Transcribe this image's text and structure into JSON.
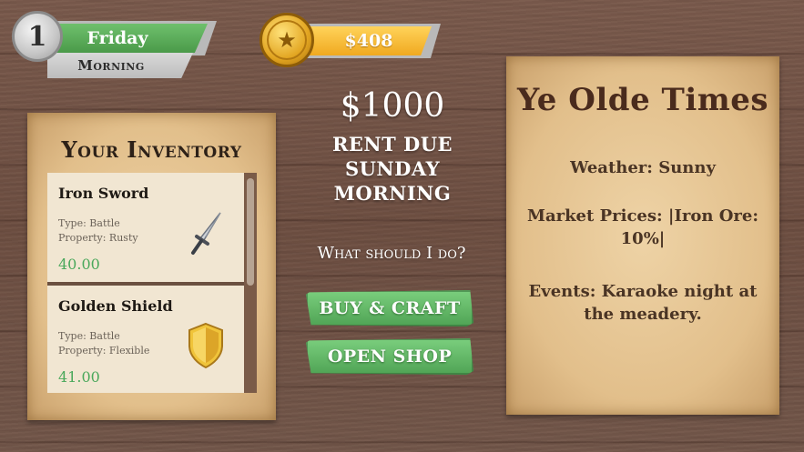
{
  "hud": {
    "day_number": "1",
    "day_name": "Friday",
    "time_of_day": "Morning",
    "money": "$408",
    "coin_icon": "star-coin-icon"
  },
  "inventory": {
    "title": "Your Inventory",
    "items": [
      {
        "name": "Iron Sword",
        "type": "Type: Battle",
        "property": "Property: Rusty",
        "price": "40.00",
        "icon": "sword-icon"
      },
      {
        "name": "Golden Shield",
        "type": "Type: Battle",
        "property": "Property: Flexible",
        "price": "41.00",
        "icon": "shield-icon"
      }
    ]
  },
  "rent": {
    "amount": "$1000",
    "line1": "RENT DUE",
    "line2": "SUNDAY",
    "line3": "MORNING"
  },
  "actions": {
    "prompt": "What should I do?",
    "buy_craft": "BUY & CRAFT",
    "open_shop": "OPEN SHOP"
  },
  "news": {
    "title": "Ye Olde Times",
    "weather": "Weather: Sunny",
    "market": "Market Prices: |Iron Ore: 10%|",
    "events": "Events: Karaoke night at the meadery."
  },
  "colors": {
    "day_ribbon": "#5aae59",
    "money_ribbon": "#f5b62c",
    "button_green": "#5fb664",
    "price_green": "#4aa85b",
    "wood": "#74564a",
    "parchment": "#e6c493"
  }
}
